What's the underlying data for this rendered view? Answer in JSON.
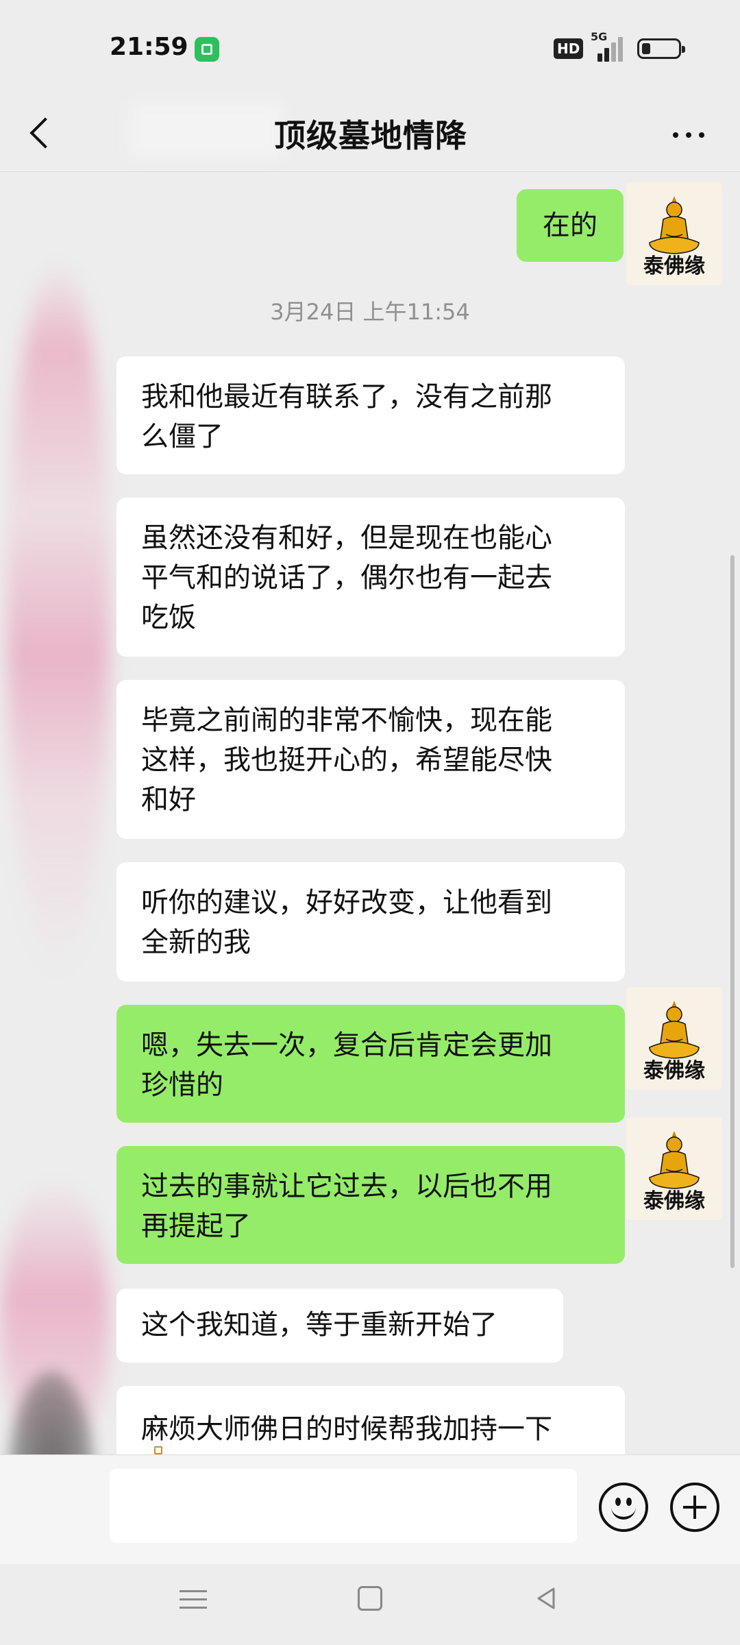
{
  "status_bar": {
    "time": "21:59",
    "hd_badge": "HD",
    "network_label": "5G",
    "notification_icon": "green-app-icon",
    "battery_icon": "battery-low-icon"
  },
  "header": {
    "title": "顶级墓地情降",
    "back_icon": "back-chevron-icon",
    "more_icon": "more-dots-icon"
  },
  "avatar": {
    "label": "泰佛缘",
    "image": "golden-buddha-image"
  },
  "timestamp": "3月24日 上午11:54",
  "messages": [
    {
      "side": "right",
      "text": "在的"
    },
    {
      "side": "left",
      "lines": [
        "我和他最近有联系了，没有之前那",
        "么僵了"
      ]
    },
    {
      "side": "left",
      "lines": [
        "虽然还没有和好，但是现在也能心",
        "平气和的说话了，偶尔也有一起去",
        "吃饭"
      ]
    },
    {
      "side": "left",
      "lines": [
        "毕竟之前闹的非常不愉快，现在能",
        "这样，我也挺开心的，希望能尽快",
        "和好"
      ]
    },
    {
      "side": "left",
      "lines": [
        "听你的建议，好好改变，让他看到",
        "全新的我"
      ]
    },
    {
      "side": "right",
      "lines": [
        "嗯，失去一次，复合后肯定会更加",
        "珍惜的"
      ]
    },
    {
      "side": "right",
      "lines": [
        "过去的事就让它过去，以后也不用",
        "再提起了"
      ]
    },
    {
      "side": "left",
      "text": "这个我知道，等于重新开始了"
    },
    {
      "side": "left",
      "text": "麻烦大师佛日的时候帮我加持一下"
    }
  ],
  "input_bar": {
    "emoji_icon": "emoji-smile-icon",
    "plus_icon": "plus-circle-icon"
  },
  "nav_bar": {
    "menu_icon": "menu-lines-icon",
    "home_icon": "home-square-icon",
    "back_icon": "back-triangle-icon"
  },
  "colors": {
    "background": "#ededed",
    "outgoing_bubble": "#95ec69",
    "incoming_bubble": "#ffffff",
    "timestamp_text": "#8f8f8f"
  }
}
